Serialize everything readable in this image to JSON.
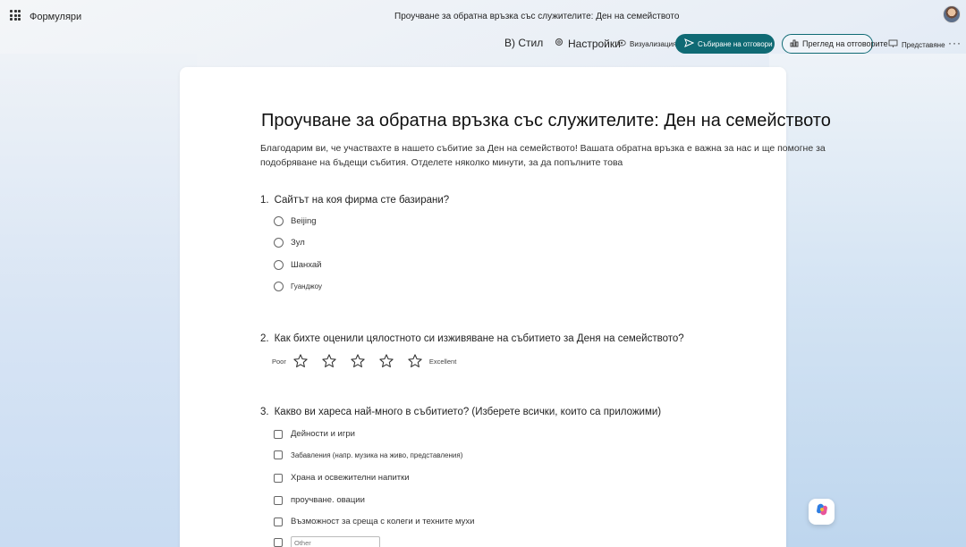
{
  "app": {
    "name": "Формуляри",
    "document_title": "Проучване за обратна връзка със служителите: Ден на семейството"
  },
  "toolbar": {
    "style_label": "В) Стил",
    "settings_label": "Настройки",
    "preview_label": "Визуализация",
    "collect_label": "Събиране на отговори",
    "responses_label": "Преглед на отговорите",
    "present_label": "Представяне",
    "more_label": "···"
  },
  "form": {
    "title": "Проучване за обратна връзка със служителите: Ден на семейството",
    "description": "Благодарим ви, че участвахте в нашето събитие за Ден на семейството! Вашата обратна връзка е важна за нас и ще помогне за подобряване на бъдещи събития. Отделете няколко минути, за да попълните това",
    "questions": [
      {
        "number": "1.",
        "text": "Сайтът на коя фирма сте базирани?",
        "options": [
          "Beijing",
          "Зул",
          "Шанхай",
          "Гуанджоу"
        ]
      },
      {
        "number": "2.",
        "text": "Как бихте оценили цялостното си изживяване на събитието за Деня на семейството?",
        "rating": {
          "low_label": "Poor",
          "high_label": "Excellent",
          "stars": 5
        }
      },
      {
        "number": "3.",
        "text": "Какво ви хареса най-много в събитието? (Изберете всички, които са приложими)",
        "options": [
          "Дейности и игри",
          "Забавления (напр. музика на живо, представления)",
          "Храна и освежителни напитки",
          "проучване. овации",
          "Възможност за среща с колеги и техните мухи"
        ],
        "other_placeholder": "Other"
      }
    ]
  }
}
